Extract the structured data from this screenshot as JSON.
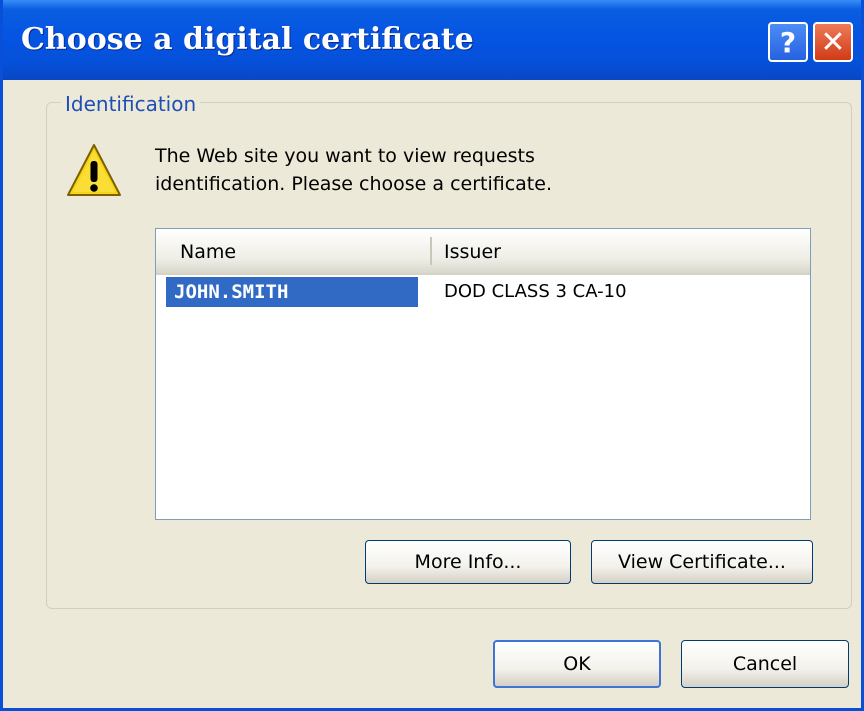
{
  "window": {
    "title": "Choose a digital certificate",
    "help_label": "?",
    "close_label": "✕",
    "colors": {
      "title_bar": "#0554e3",
      "selection": "#316ac5",
      "dialog_bg": "#ece9d8"
    }
  },
  "group": {
    "legend": "Identification",
    "icon": "warning-icon",
    "message_line1": "The Web site you want to view requests",
    "message_line2": "identification. Please choose a certificate."
  },
  "certificates": {
    "columns": [
      "Name",
      "Issuer"
    ],
    "rows": [
      {
        "name": "JOHN.SMITH",
        "issuer": "DOD CLASS 3 CA-10",
        "selected": true
      }
    ]
  },
  "buttons": {
    "more_info": "More Info...",
    "view_certificate": "View Certificate...",
    "ok": "OK",
    "cancel": "Cancel"
  }
}
